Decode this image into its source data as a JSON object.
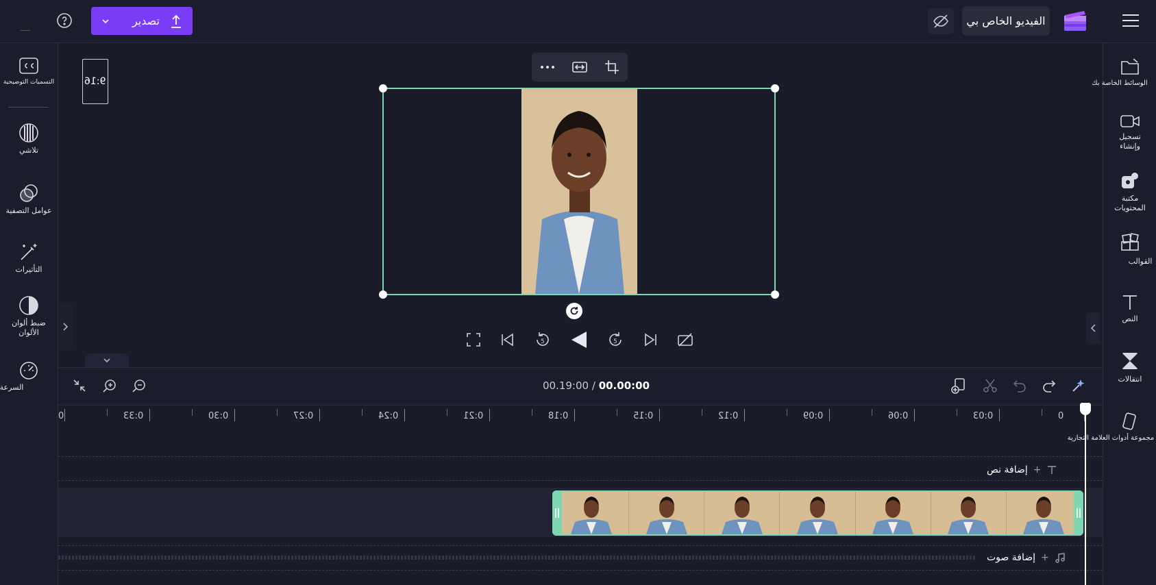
{
  "header": {
    "export_label": "تصدير",
    "project_title": "الفيديو الخاص بي",
    "icons": [
      "upload-icon",
      "chevron-down-icon",
      "help-icon",
      "hamburger-menu-icon",
      "clipchamp-logo",
      "eye-off-icon"
    ],
    "accent_color": "#7b3cf5"
  },
  "left_sidebar": {
    "items": [
      {
        "label": "التسميات التوضيحية",
        "icon": "closed-captions-icon"
      },
      {
        "label": "تلاشي",
        "icon": "fade-icon"
      },
      {
        "label": "عوامل التصفية",
        "icon": "filters-icon"
      },
      {
        "label": "التأثيرات",
        "icon": "magic-wand-icon"
      },
      {
        "label": "ضبط ألوان الألوان",
        "icon": "color-adjust-icon"
      },
      {
        "label": "السرعة",
        "icon": "speedometer-icon"
      }
    ]
  },
  "right_sidebar": {
    "items": [
      {
        "label": "الوسائط الخاصة بك",
        "icon": "folder-icon"
      },
      {
        "label": "تسجيل وإنشاء",
        "icon": "video-camera-icon"
      },
      {
        "label": "مكتبة المحتويات",
        "icon": "content-library-icon"
      },
      {
        "label": "القوالب",
        "icon": "templates-icon"
      },
      {
        "label": "النص",
        "icon": "text-icon"
      },
      {
        "label": "انتقالات",
        "icon": "transitions-icon"
      },
      {
        "label": "مجموعة أدوات العلامة التجارية",
        "icon": "brand-kit-icon"
      }
    ]
  },
  "preview": {
    "aspect_ratio": "9:16",
    "float_toolbar": [
      "crop-icon",
      "fit-icon",
      "more-icon"
    ],
    "playback": [
      "fullscreen-icon",
      "skip-back-icon",
      "rewind-5-icon",
      "play-icon",
      "forward-5-icon",
      "skip-forward-icon",
      "camera-off-icon"
    ],
    "selection_color": "#7fd6b3"
  },
  "timeline": {
    "current_time": "00.00:00",
    "total_time": "00.19:00",
    "separator": "/",
    "ruler_ticks": [
      "0",
      "0:03",
      "0:06",
      "0:09",
      "0:12",
      "0:15",
      "0:18",
      "0:21",
      "0:24",
      "0:27",
      "0:30",
      "0:33",
      "0"
    ],
    "add_text_label": "إضافة نص",
    "add_audio_label": "إضافة صوت",
    "plus": "+",
    "clip_frames": 7,
    "tools": [
      "magic-icon",
      "redo-icon",
      "undo-icon",
      "scissors-icon",
      "add-media-icon",
      "zoom-out-icon",
      "zoom-in-icon",
      "fit-timeline-icon"
    ]
  }
}
